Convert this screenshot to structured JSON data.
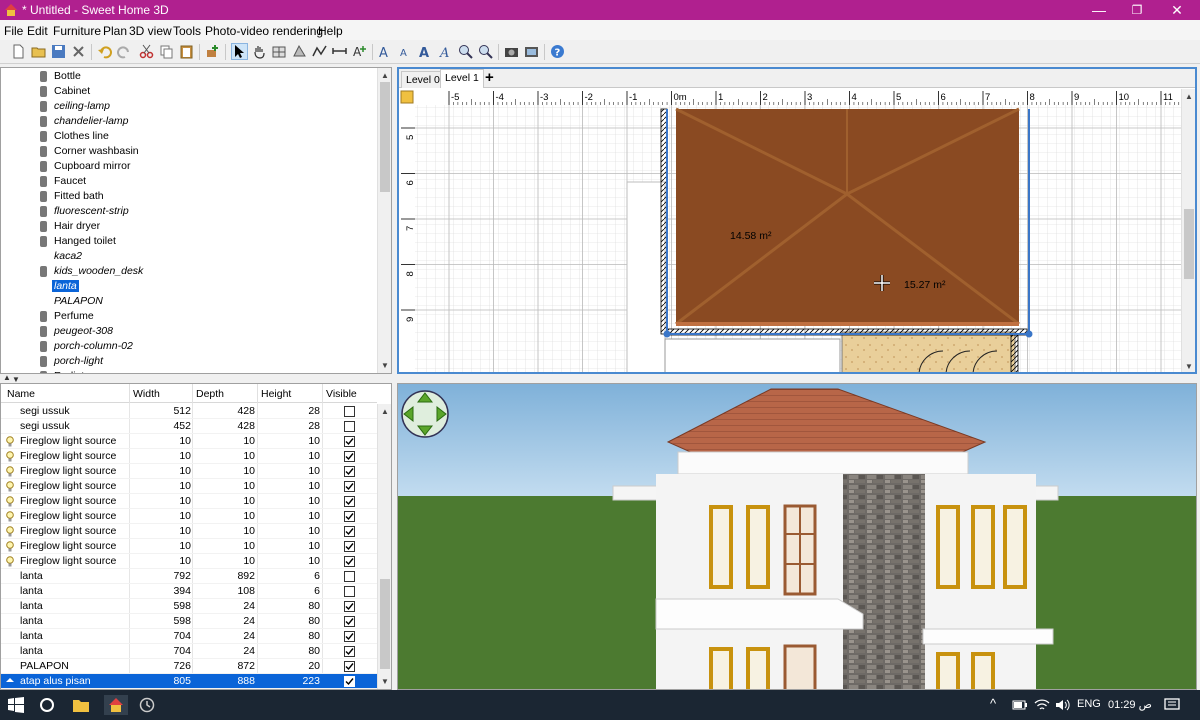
{
  "window": {
    "title": "* Untitled - Sweet Home 3D",
    "minimize": "—",
    "maximize": "❐",
    "close": "✕"
  },
  "menu": [
    "File",
    "Edit",
    "Furniture",
    "Plan",
    "3D view",
    "Tools",
    "Photo-video rendering",
    "Help"
  ],
  "catalog": {
    "items": [
      {
        "label": "Bottle",
        "italic": false,
        "icon": "bottle-icon"
      },
      {
        "label": "Cabinet",
        "italic": false,
        "icon": "cabinet-icon"
      },
      {
        "label": "ceiling-lamp",
        "italic": true,
        "icon": "lamp-icon"
      },
      {
        "label": "chandelier-lamp",
        "italic": true,
        "icon": "lamp-icon"
      },
      {
        "label": "Clothes line",
        "italic": false,
        "icon": "clothes-line-icon"
      },
      {
        "label": "Corner washbasin",
        "italic": false,
        "icon": "washbasin-icon"
      },
      {
        "label": "Cupboard mirror",
        "italic": false,
        "icon": "mirror-icon"
      },
      {
        "label": "Faucet",
        "italic": false,
        "icon": "faucet-icon"
      },
      {
        "label": "Fitted bath",
        "italic": false,
        "icon": "bath-icon"
      },
      {
        "label": "fluorescent-strip",
        "italic": true,
        "icon": "strip-icon"
      },
      {
        "label": "Hair dryer",
        "italic": false,
        "icon": "hair-dryer-icon"
      },
      {
        "label": "Hanged toilet",
        "italic": false,
        "icon": "toilet-icon"
      },
      {
        "label": "kaca2",
        "italic": true,
        "icon": "blank-icon"
      },
      {
        "label": "kids_wooden_desk",
        "italic": true,
        "icon": "desk-icon"
      },
      {
        "label": "lanta",
        "italic": true,
        "icon": "blank-icon",
        "selected": true
      },
      {
        "label": "PALAPON",
        "italic": true,
        "icon": "blank-icon"
      },
      {
        "label": "Perfume",
        "italic": false,
        "icon": "perfume-icon"
      },
      {
        "label": "peugeot-308",
        "italic": true,
        "icon": "car-icon"
      },
      {
        "label": "porch-column-02",
        "italic": true,
        "icon": "column-icon"
      },
      {
        "label": "porch-light",
        "italic": true,
        "icon": "light-icon"
      },
      {
        "label": "Radiator",
        "italic": false,
        "icon": "radiator-icon"
      }
    ]
  },
  "furniture_table": {
    "columns": [
      "Name",
      "Width",
      "Depth",
      "Height",
      "Visible"
    ],
    "rows": [
      {
        "name": "segi ussuk",
        "width": "512",
        "depth": "428",
        "height": "28",
        "visible": false,
        "lamp": false
      },
      {
        "name": "segi ussuk",
        "width": "452",
        "depth": "428",
        "height": "28",
        "visible": false,
        "lamp": false
      },
      {
        "name": "Fireglow light source",
        "width": "10",
        "depth": "10",
        "height": "10",
        "visible": true,
        "lamp": true
      },
      {
        "name": "Fireglow light source",
        "width": "10",
        "depth": "10",
        "height": "10",
        "visible": true,
        "lamp": true
      },
      {
        "name": "Fireglow light source",
        "width": "10",
        "depth": "10",
        "height": "10",
        "visible": true,
        "lamp": true
      },
      {
        "name": "Fireglow light source",
        "width": "10",
        "depth": "10",
        "height": "10",
        "visible": true,
        "lamp": true
      },
      {
        "name": "Fireglow light source",
        "width": "10",
        "depth": "10",
        "height": "10",
        "visible": true,
        "lamp": true
      },
      {
        "name": "Fireglow light source",
        "width": "10",
        "depth": "10",
        "height": "10",
        "visible": true,
        "lamp": true
      },
      {
        "name": "Fireglow light source",
        "width": "10",
        "depth": "10",
        "height": "10",
        "visible": true,
        "lamp": true
      },
      {
        "name": "Fireglow light source",
        "width": "10",
        "depth": "10",
        "height": "10",
        "visible": true,
        "lamp": true
      },
      {
        "name": "Fireglow light source",
        "width": "10",
        "depth": "10",
        "height": "10",
        "visible": true,
        "lamp": true
      },
      {
        "name": "lanta",
        "width": "792",
        "depth": "892",
        "height": "6",
        "visible": false,
        "lamp": false
      },
      {
        "name": "lanta",
        "width": "394",
        "depth": "108",
        "height": "6",
        "visible": false,
        "lamp": false
      },
      {
        "name": "lanta",
        "width": "598",
        "depth": "24",
        "height": "80",
        "visible": true,
        "lamp": false
      },
      {
        "name": "lanta",
        "width": "598",
        "depth": "24",
        "height": "80",
        "visible": true,
        "lamp": false
      },
      {
        "name": "lanta",
        "width": "704",
        "depth": "24",
        "height": "80",
        "visible": true,
        "lamp": false
      },
      {
        "name": "lanta",
        "width": "704",
        "depth": "24",
        "height": "80",
        "visible": true,
        "lamp": false
      },
      {
        "name": "PALAPON",
        "width": "726",
        "depth": "872",
        "height": "20",
        "visible": true,
        "lamp": false
      },
      {
        "name": "atap alus pisan",
        "width": "805",
        "depth": "888",
        "height": "223",
        "visible": true,
        "lamp": false,
        "selected": true
      }
    ]
  },
  "plan": {
    "tabs": [
      "Level 0",
      "Level 1"
    ],
    "active_tab": "Level 1",
    "add_level": "+",
    "ruler_x": [
      "-5",
      "-4",
      "-3",
      "-2",
      "-1",
      "0m",
      "1",
      "2",
      "3",
      "4",
      "5",
      "6",
      "7",
      "8",
      "9",
      "10",
      "11"
    ],
    "ruler_y": [
      "5",
      "6",
      "7",
      "8",
      "9"
    ],
    "room_labels": [
      "14.58 m²",
      "15.27 m²"
    ],
    "roof_color": "#8a4a22"
  },
  "taskbar": {
    "language": "ENG",
    "time": "01:29 ص",
    "tray_up": "^"
  },
  "colors": {
    "titlebar": "#b0208f",
    "selection": "#0a64d8",
    "plan_border": "#4a8ad0",
    "sky": "#a8c8e0",
    "grass": "#4c7a30"
  }
}
